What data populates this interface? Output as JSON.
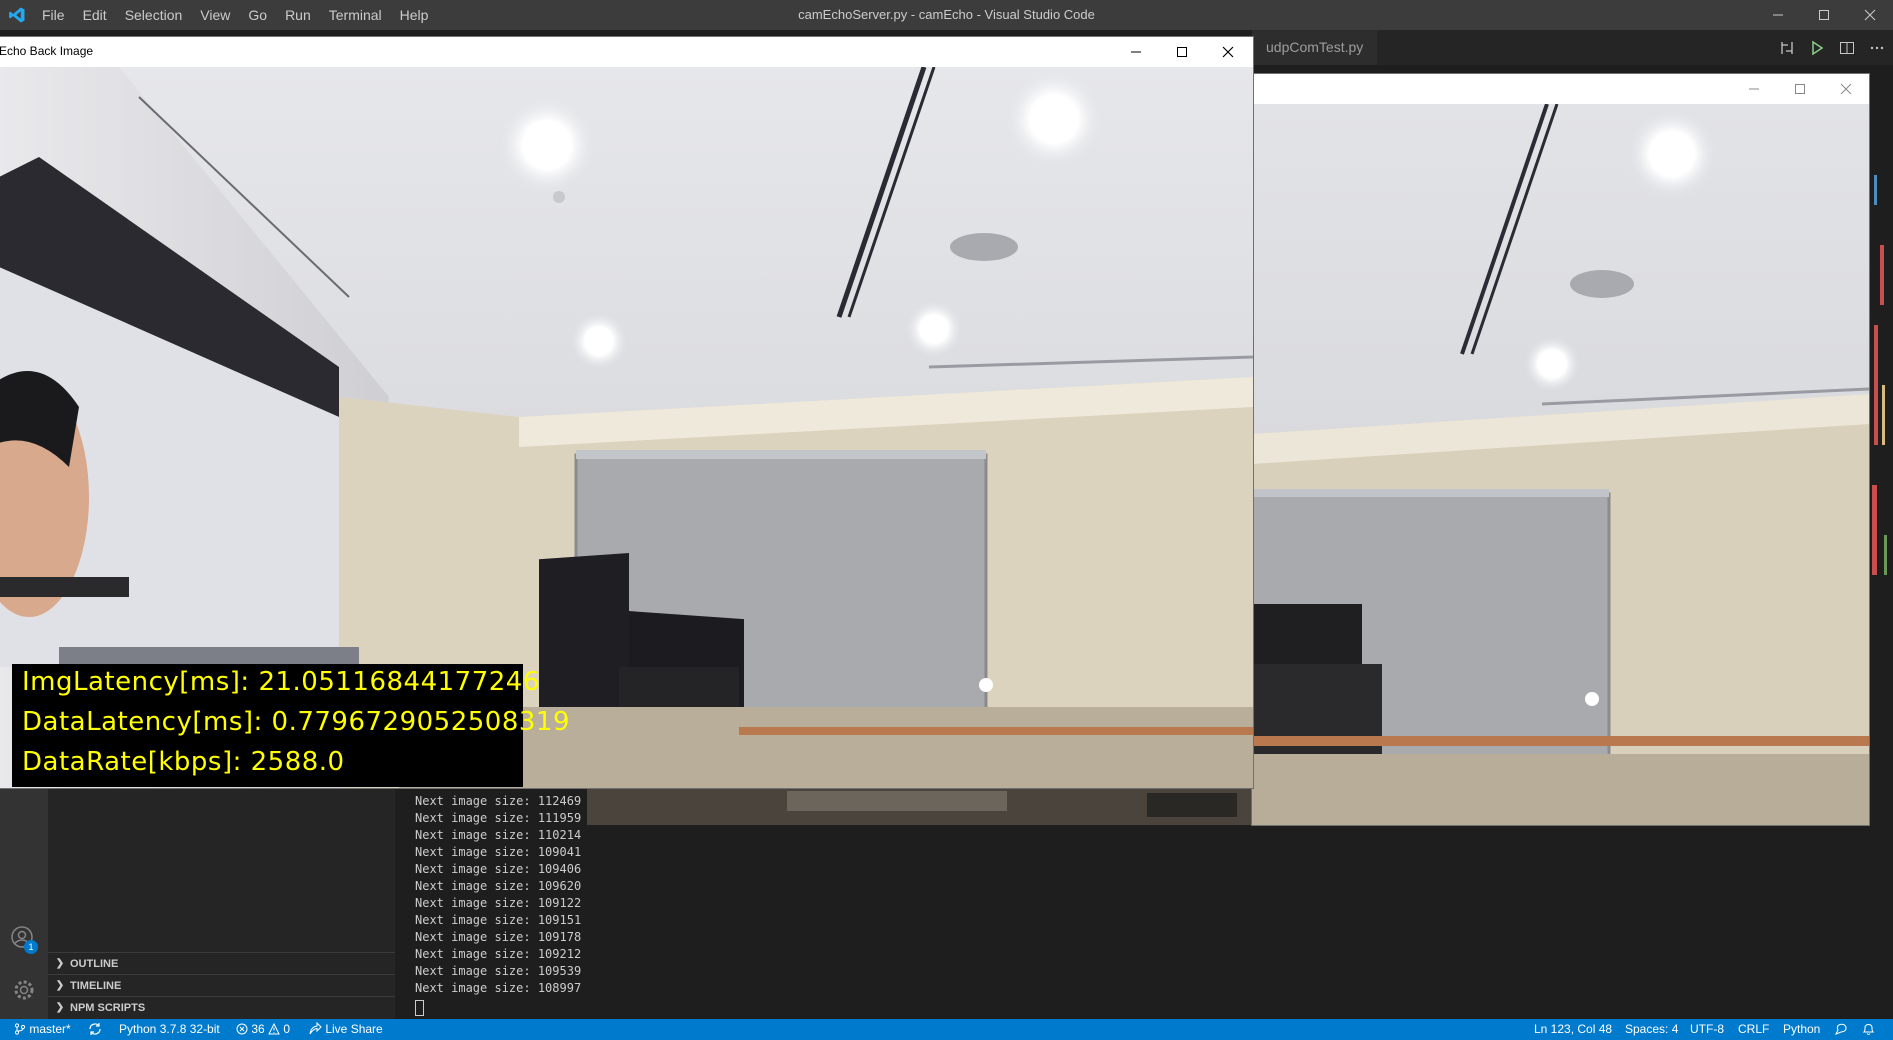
{
  "vscode": {
    "menu": [
      "File",
      "Edit",
      "Selection",
      "View",
      "Go",
      "Run",
      "Terminal",
      "Help"
    ],
    "window_title": "camEchoServer.py - camEcho - Visual Studio Code",
    "tab_label": "udpComTest.py",
    "sidebar_sections": [
      "OUTLINE",
      "TIMELINE",
      "NPM SCRIPTS"
    ],
    "accounts_badge": "1"
  },
  "terminal": {
    "lines": [
      "Next image size: 112469",
      "Next image size: 111959",
      "Next image size: 110214",
      "Next image size: 109041",
      "Next image size: 109406",
      "Next image size: 109620",
      "Next image size: 109122",
      "Next image size: 109151",
      "Next image size: 109178",
      "Next image size: 109212",
      "Next image size: 109539",
      "Next image size: 108997"
    ]
  },
  "statusbar": {
    "branch": "master*",
    "interpreter": "Python 3.7.8 32-bit",
    "errors": "36",
    "warnings": "0",
    "live_share": "Live Share",
    "cursor": "Ln 123, Col 48",
    "spaces": "Spaces: 4",
    "encoding": "UTF-8",
    "eol": "CRLF",
    "language": "Python"
  },
  "echo_window": {
    "title": "Echo Back Image",
    "overlay": {
      "img_latency": "ImgLatency[ms]: 21.05116844177246",
      "data_latency": "DataLatency[ms]: 0.7796729052508319",
      "data_rate": "DataRate[kbps]: 2588.0"
    }
  },
  "colors": {
    "titlebar": "#3c3c3c",
    "statusbar": "#007acc",
    "overlay_text": "#ffff00"
  }
}
